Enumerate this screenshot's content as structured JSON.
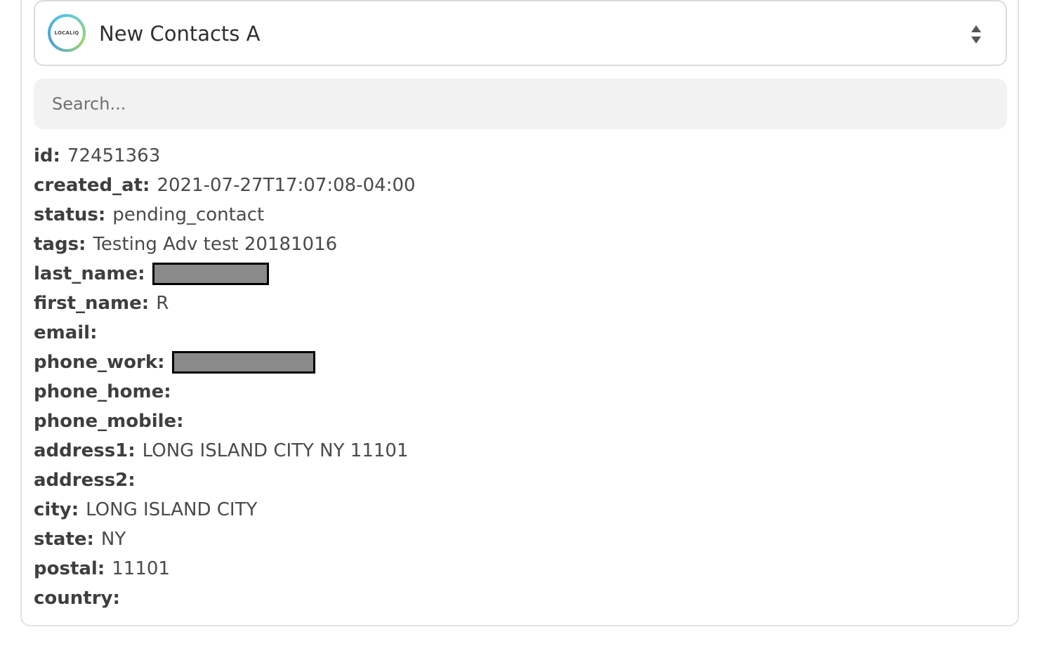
{
  "selector": {
    "logo_text": "LOCALiQ",
    "title": "New Contacts A",
    "icon": "sort-updown-icon"
  },
  "search": {
    "placeholder": "Search..."
  },
  "fields": [
    {
      "key": "id:",
      "value": "72451363",
      "redacted": false
    },
    {
      "key": "created_at:",
      "value": "2021-07-27T17:07:08-04:00",
      "redacted": false
    },
    {
      "key": "status:",
      "value": "pending_contact",
      "redacted": false
    },
    {
      "key": "tags:",
      "value": "Testing Adv test 20181016",
      "redacted": false
    },
    {
      "key": "last_name:",
      "value": "",
      "redacted": true
    },
    {
      "key": "first_name:",
      "value": "R",
      "redacted": false
    },
    {
      "key": "email:",
      "value": "",
      "redacted": false
    },
    {
      "key": "phone_work:",
      "value": "",
      "redacted": true
    },
    {
      "key": "phone_home:",
      "value": "",
      "redacted": false
    },
    {
      "key": "phone_mobile:",
      "value": "",
      "redacted": false
    },
    {
      "key": "address1:",
      "value": "LONG ISLAND CITY NY 11101",
      "redacted": false
    },
    {
      "key": "address2:",
      "value": "",
      "redacted": false
    },
    {
      "key": "city:",
      "value": "LONG ISLAND CITY",
      "redacted": false
    },
    {
      "key": "state:",
      "value": "NY",
      "redacted": false
    },
    {
      "key": "postal:",
      "value": "11101",
      "redacted": false
    },
    {
      "key": "country:",
      "value": "",
      "redacted": false
    }
  ],
  "colors": {
    "border": "#dcdcdc",
    "search_bg": "#f2f2f2",
    "redaction_fill": "#8a8a8a"
  }
}
